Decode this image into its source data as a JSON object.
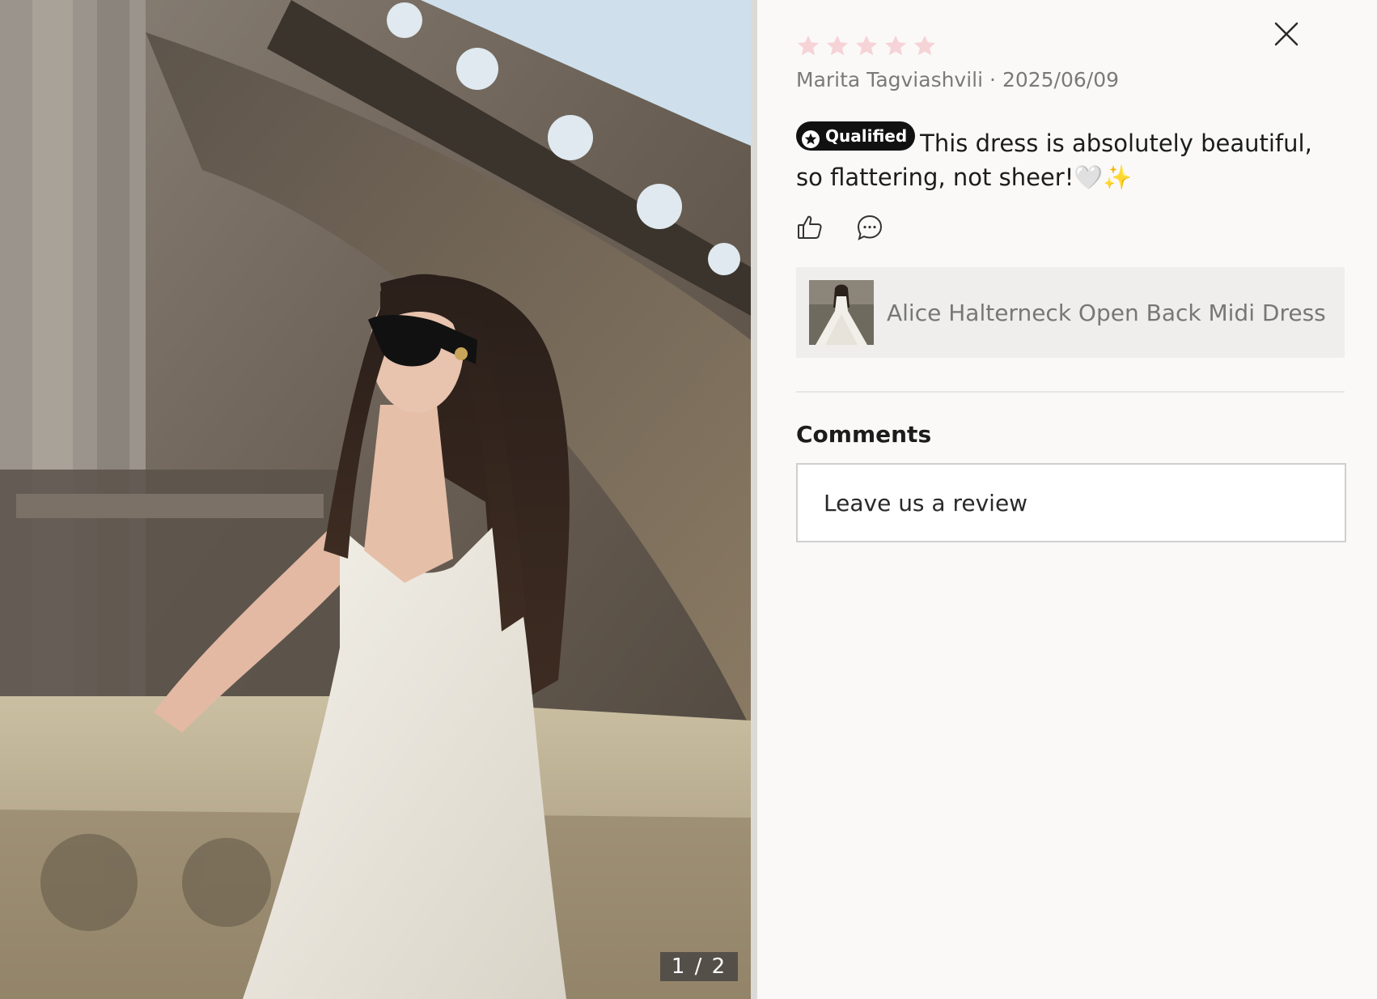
{
  "photo": {
    "counter": "1 / 2"
  },
  "review": {
    "rating": 5,
    "max_rating": 5,
    "star_color": "#f6d3d6",
    "author": "Marita Tagviashvili",
    "separator": "·",
    "date": "2025/06/09",
    "badge_label": "Qualified",
    "text": "This dress is absolutely beautiful, so flattering, not sheer!🤍✨"
  },
  "actions": {
    "like_icon": "thumbs-up-icon",
    "comment_icon": "chat-bubble-icon"
  },
  "product": {
    "name": "Alice Halterneck Open Back Midi Dress"
  },
  "comments": {
    "title": "Comments",
    "placeholder": "Leave us a review"
  },
  "close_icon": "close-icon"
}
